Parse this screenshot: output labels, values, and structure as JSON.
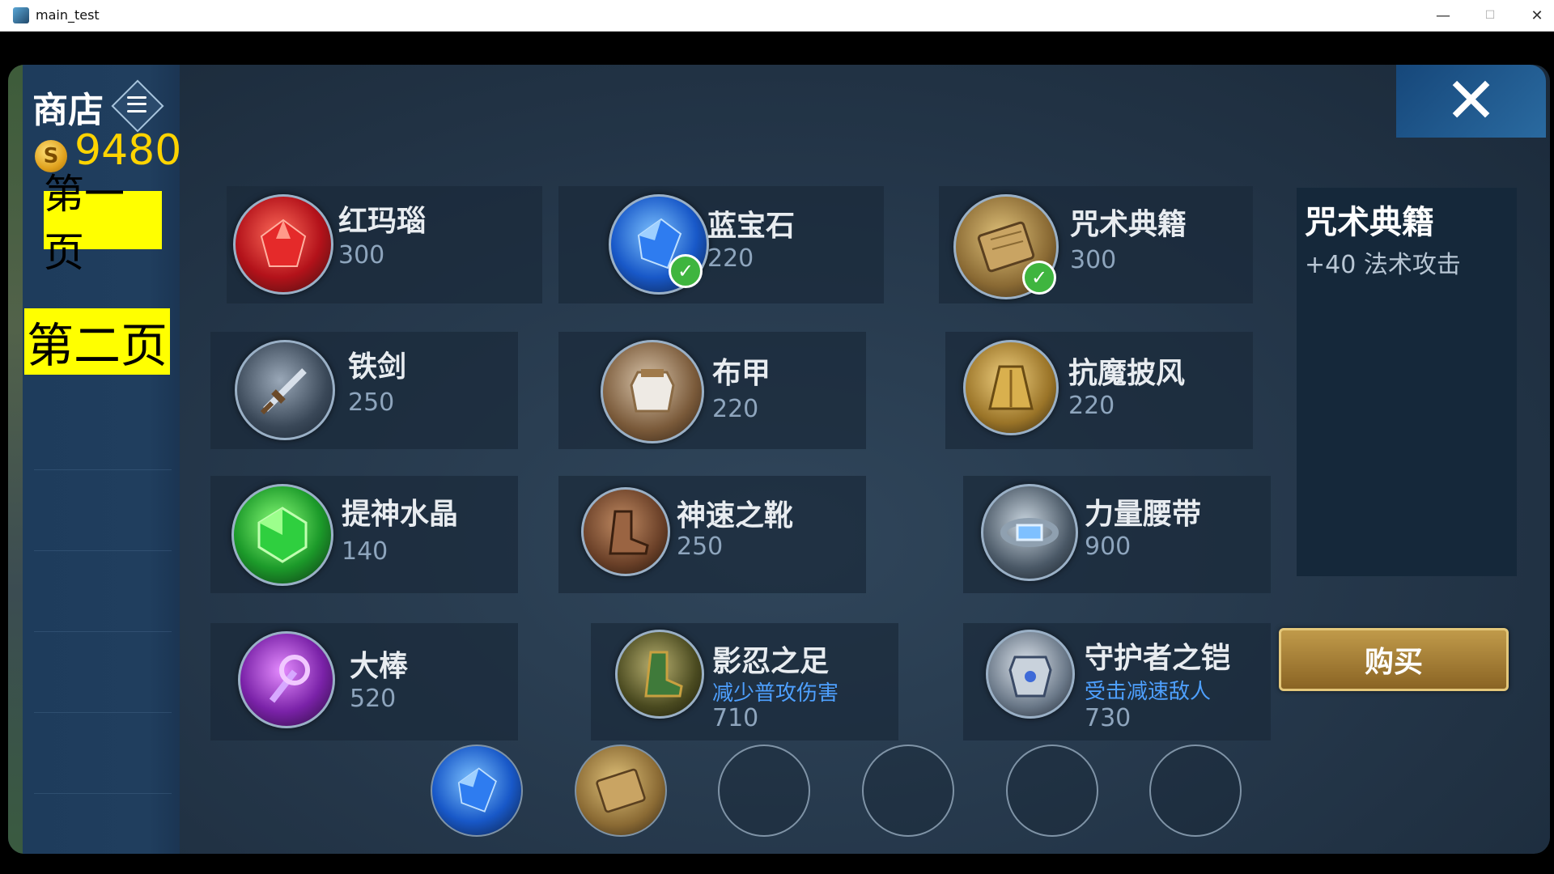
{
  "window": {
    "title": "main_test",
    "minimize": "—",
    "maximize": "☐",
    "close": "✕"
  },
  "shop": {
    "title": "商店",
    "gold": "9480",
    "coin_symbol": "S",
    "page1": "第一页",
    "page2": "第二页",
    "close_symbol": "✕"
  },
  "items": [
    {
      "name": "红玛瑙",
      "price": "300",
      "icon": "red-agate-icon",
      "owned": false
    },
    {
      "name": "蓝宝石",
      "price": "220",
      "icon": "sapphire-icon",
      "owned": true
    },
    {
      "name": "咒术典籍",
      "price": "300",
      "icon": "spell-book-icon",
      "owned": true
    },
    {
      "name": "铁剑",
      "price": "250",
      "icon": "iron-sword-icon",
      "owned": false
    },
    {
      "name": "布甲",
      "price": "220",
      "icon": "cloth-armor-icon",
      "owned": false
    },
    {
      "name": "抗魔披风",
      "price": "220",
      "icon": "anti-magic-cloak-icon",
      "owned": false
    },
    {
      "name": "提神水晶",
      "price": "140",
      "icon": "refresh-crystal-icon",
      "owned": false
    },
    {
      "name": "神速之靴",
      "price": "250",
      "icon": "swift-boots-icon",
      "owned": false
    },
    {
      "name": "力量腰带",
      "price": "900",
      "icon": "power-belt-icon",
      "owned": false
    },
    {
      "name": "大棒",
      "price": "520",
      "icon": "big-staff-icon",
      "owned": false
    },
    {
      "name": "影忍之足",
      "price": "710",
      "effect": "减少普攻伤害",
      "icon": "shadow-ninja-boots-icon",
      "owned": false
    },
    {
      "name": "守护者之铠",
      "price": "730",
      "effect": "受击减速敌人",
      "icon": "guardian-armor-icon",
      "owned": false
    }
  ],
  "detail": {
    "name": "咒术典籍",
    "effect": "+40 法术攻击"
  },
  "buy_label": "购买",
  "inventory": [
    "sapphire-icon",
    "spell-book-icon",
    "",
    "",
    "",
    ""
  ],
  "colors": {
    "gold": "#ffd400",
    "page_button": "#ffff00",
    "owned_check": "#3fb53f",
    "effect_text": "#4ea0ff"
  }
}
